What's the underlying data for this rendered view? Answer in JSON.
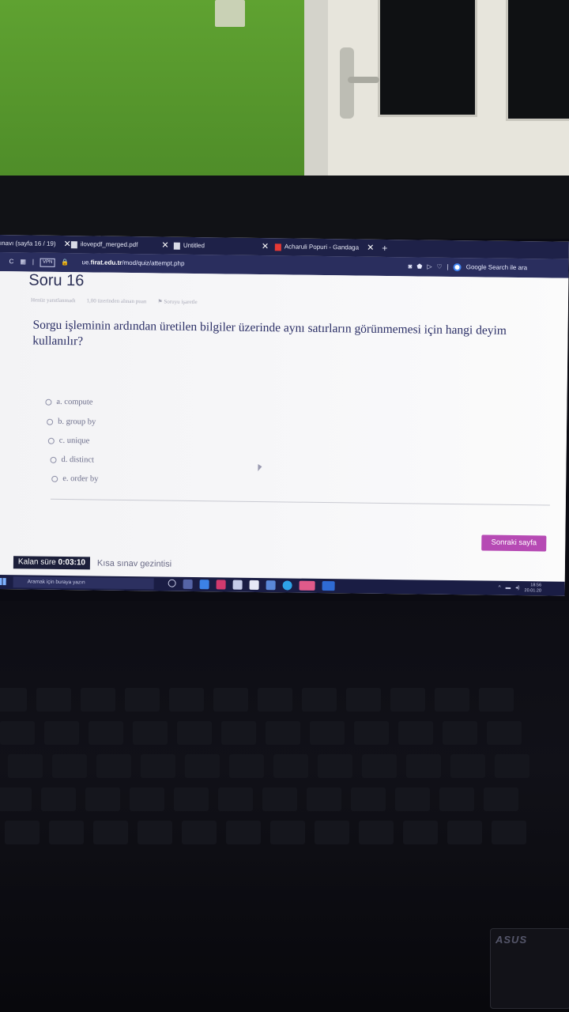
{
  "browser": {
    "tabs": [
      {
        "label": "ınavı (sayfa 16 / 19)"
      },
      {
        "label": "ilovepdf_merged.pdf"
      },
      {
        "label": "Untitled"
      },
      {
        "label": "Acharuli Popuri - Gandaga"
      }
    ],
    "new_tab_label": "+",
    "url_prefix": "ue.",
    "url_domain": "firat.edu.tr",
    "url_path": "/mod/quiz/attempt.php",
    "vpn_label": "VPN",
    "search_label": "Google Search ile ara"
  },
  "quiz": {
    "title": "Soru 16",
    "status": "Henüz yanıtlanmadı",
    "points": "1,00 üzerinden alınan puan",
    "flag": "Soruyu işaretle",
    "question": "Sorgu işleminin ardından üretilen bilgiler üzerinde aynı satırların görünmemesi için hangi deyim kullanılır?",
    "options": [
      "a. compute",
      "b. group by",
      "c. unique",
      "d. distinct",
      "e. order by"
    ],
    "next_label": "Sonraki sayfa",
    "timer_label": "Kalan süre",
    "timer_value": "0:03:10",
    "nav_label": "Kısa sınav gezintisi"
  },
  "taskbar": {
    "search_placeholder": "Aramak için buraya yazın",
    "time": "18:56",
    "date": "20.01.20"
  },
  "laptop": {
    "brand": "ASUS"
  }
}
